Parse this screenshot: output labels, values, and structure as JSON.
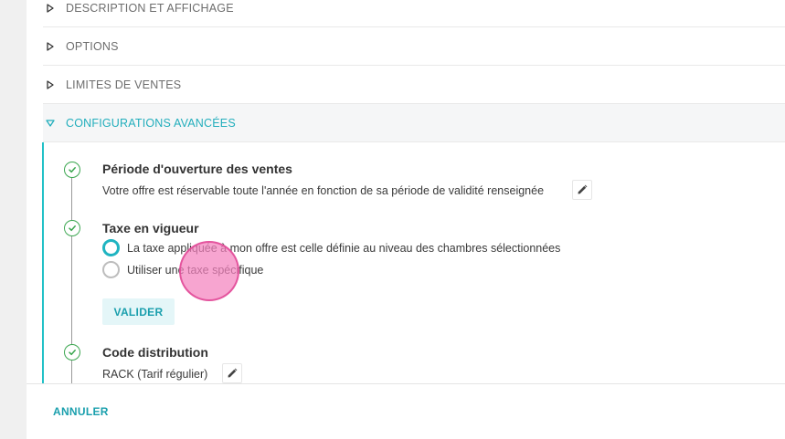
{
  "sections": [
    {
      "label": "DESCRIPTION ET AFFICHAGE",
      "open": false
    },
    {
      "label": "OPTIONS",
      "open": false
    },
    {
      "label": "LIMITES DE VENTES",
      "open": false
    },
    {
      "label": "CONFIGURATIONS AVANCÉES",
      "open": true
    }
  ],
  "advanced": {
    "opening_period": {
      "title": "Période d'ouverture des ventes",
      "description": "Votre offre est réservable toute l'année en fonction de sa période de validité renseignée"
    },
    "tax": {
      "title": "Taxe en vigueur",
      "options": [
        {
          "label": "La taxe appliquée à mon offre est celle définie au niveau des chambres sélectionnées",
          "checked": true
        },
        {
          "label": "Utiliser une taxe spécifique",
          "checked": false
        }
      ],
      "validate_label": "VALIDER"
    },
    "distribution_code": {
      "title": "Code distribution",
      "value": "RACK (Tarif régulier)"
    }
  },
  "footer": {
    "cancel_label": "ANNULER"
  },
  "colors": {
    "accent": "#22aebc",
    "check_green": "#3aa64f",
    "cursor_highlight": "#f482be"
  },
  "icons": {
    "collapsed": "triangle-right-icon",
    "expanded": "triangle-down-icon",
    "completed": "check-circle-icon",
    "edit": "pencil-icon"
  }
}
